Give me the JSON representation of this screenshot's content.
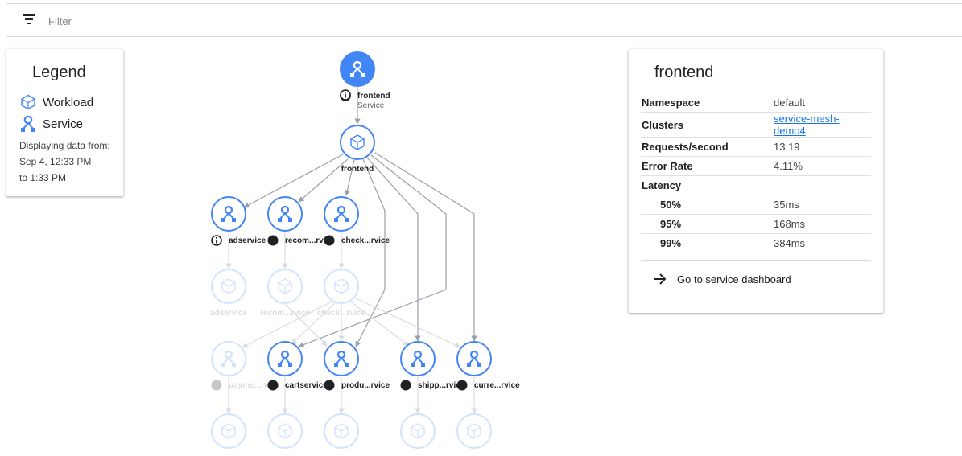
{
  "filter": {
    "placeholder": "Filter"
  },
  "legend": {
    "title": "Legend",
    "workload_label": "Workload",
    "service_label": "Service",
    "note_line1": "Displaying data from:",
    "note_line2": "Sep 4, 12:33 PM",
    "note_line3": "to 1:33 PM"
  },
  "detail": {
    "title": "frontend",
    "rows": [
      {
        "key": "Namespace",
        "value": "default"
      },
      {
        "key": "Clusters",
        "value": "service-mesh-demo4"
      },
      {
        "key": "Requests/second",
        "value": "13.19"
      },
      {
        "key": "Error Rate",
        "value": "4.11%"
      },
      {
        "key": "Latency",
        "value": ""
      },
      {
        "key": "50%",
        "value": "35ms"
      },
      {
        "key": "95%",
        "value": "168ms"
      },
      {
        "key": "99%",
        "value": "384ms"
      }
    ],
    "action_label": "Go to service dashboard"
  },
  "graph": {
    "colors": {
      "blue": "#4285f4",
      "faded": "#d2e3fc",
      "edge": "#9aa0a6",
      "edge_faded": "#dadce0"
    },
    "nodes": [
      {
        "id": "frontend-svc",
        "label": "frontend",
        "sublabel": "Service",
        "kind": "service-selected",
        "status": "info"
      },
      {
        "id": "frontend-wl",
        "label": "frontend",
        "kind": "workload",
        "status": ""
      },
      {
        "id": "adservice-svc",
        "label": "adservice",
        "kind": "service",
        "status": "info"
      },
      {
        "id": "recom-svc",
        "label": "recom...rvice",
        "kind": "service",
        "status": "dot"
      },
      {
        "id": "check-svc",
        "label": "check...rvice",
        "kind": "service",
        "status": "dot"
      },
      {
        "id": "adservice-wl",
        "label": "adservice",
        "kind": "workload-faded",
        "status": ""
      },
      {
        "id": "recom-wl",
        "label": "recom...rvice",
        "kind": "workload-faded",
        "status": ""
      },
      {
        "id": "check-wl",
        "label": "check...rvice",
        "kind": "workload-faded",
        "status": ""
      },
      {
        "id": "payme-svc",
        "label": "payme...rvice",
        "kind": "service-faded",
        "status": "dot-faded"
      },
      {
        "id": "cart-svc",
        "label": "cartservice",
        "kind": "service",
        "status": "dot"
      },
      {
        "id": "produ-svc",
        "label": "produ...rvice",
        "kind": "service",
        "status": "dot"
      },
      {
        "id": "shipp-svc",
        "label": "shipp...rvice",
        "kind": "service",
        "status": "dot"
      },
      {
        "id": "curre-svc",
        "label": "curre...rvice",
        "kind": "service",
        "status": "dot"
      },
      {
        "id": "payme-wl",
        "label": "",
        "kind": "workload-faded",
        "status": ""
      },
      {
        "id": "cart-wl",
        "label": "",
        "kind": "workload-faded",
        "status": ""
      },
      {
        "id": "produ-wl",
        "label": "",
        "kind": "workload-faded",
        "status": ""
      },
      {
        "id": "shipp-wl",
        "label": "",
        "kind": "workload-faded",
        "status": ""
      },
      {
        "id": "curre-wl",
        "label": "",
        "kind": "workload-faded",
        "status": ""
      }
    ]
  }
}
